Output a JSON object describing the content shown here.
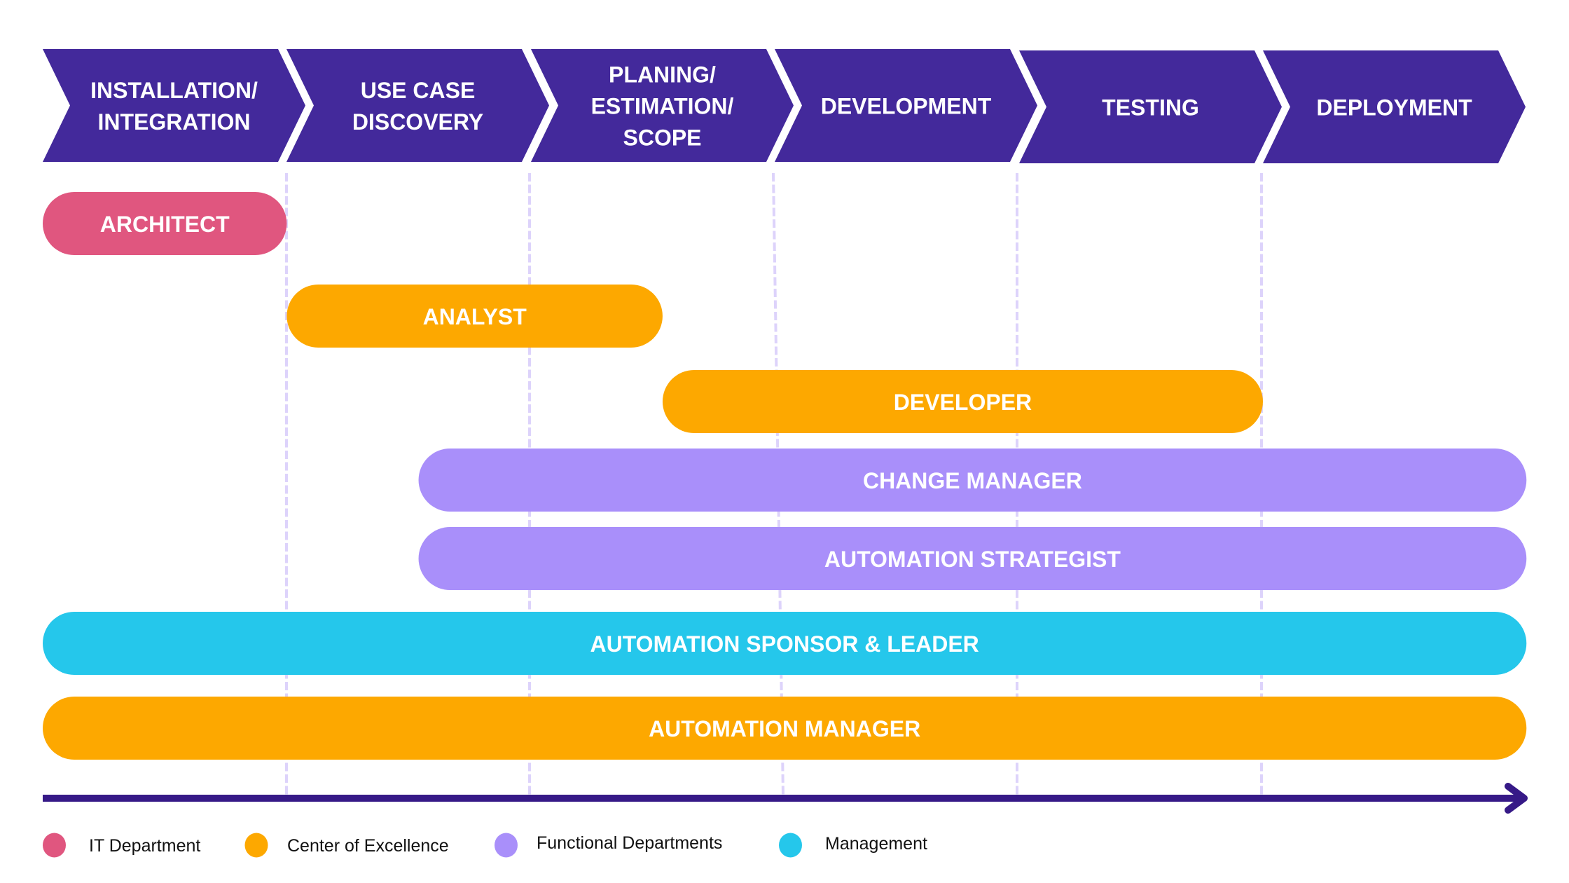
{
  "diagram": {
    "type": "phase-role-timeline",
    "colors": {
      "phase_fill": "#43299b",
      "axis": "#361987",
      "divider": "#ddd3fb",
      "text_on_shape": "#ffffff",
      "legend_text": "#111111"
    },
    "phases": [
      {
        "id": "installation-integration",
        "lines": [
          "INSTALLATION/",
          "INTEGRATION"
        ]
      },
      {
        "id": "use-case-discovery",
        "lines": [
          "USE CASE",
          "DISCOVERY"
        ]
      },
      {
        "id": "planing-estimation-scope",
        "lines": [
          "PLANING/",
          "ESTIMATION/",
          "SCOPE"
        ]
      },
      {
        "id": "development",
        "lines": [
          "DEVELOPMENT"
        ]
      },
      {
        "id": "testing",
        "lines": [
          "TESTING"
        ]
      },
      {
        "id": "deployment",
        "lines": [
          "DEPLOYMENT"
        ]
      }
    ],
    "roles": [
      {
        "id": "architect",
        "label": "ARCHITECT",
        "group": "it",
        "phase_start": 0,
        "phase_end": 1.0
      },
      {
        "id": "analyst",
        "label": "ANALYST",
        "group": "coe",
        "phase_start": 1.0,
        "phase_end": 2.54
      },
      {
        "id": "developer",
        "label": "DEVELOPER",
        "group": "coe",
        "phase_start": 2.54,
        "phase_end": 5.0
      },
      {
        "id": "change-manager",
        "label": "CHANGE MANAGER",
        "group": "functional",
        "phase_start": 1.54,
        "phase_end": 6.08
      },
      {
        "id": "automation-strategist",
        "label": "AUTOMATION STRATEGIST",
        "group": "functional",
        "phase_start": 1.54,
        "phase_end": 6.08
      },
      {
        "id": "automation-sponsor-leader",
        "label": "AUTOMATION SPONSOR & LEADER",
        "group": "management",
        "phase_start": 0,
        "phase_end": 6.08
      },
      {
        "id": "automation-manager",
        "label": "AUTOMATION MANAGER",
        "group": "coe",
        "phase_start": 0,
        "phase_end": 6.08
      }
    ],
    "legend": [
      {
        "group": "it",
        "label": "IT Department",
        "color": "#e0567f"
      },
      {
        "group": "coe",
        "label": "Center of Excellence",
        "color": "#fda800"
      },
      {
        "group": "functional",
        "label": "Functional Departments",
        "color": "#a98ffa"
      },
      {
        "group": "management",
        "label": "Management",
        "color": "#25c7eb"
      }
    ]
  }
}
